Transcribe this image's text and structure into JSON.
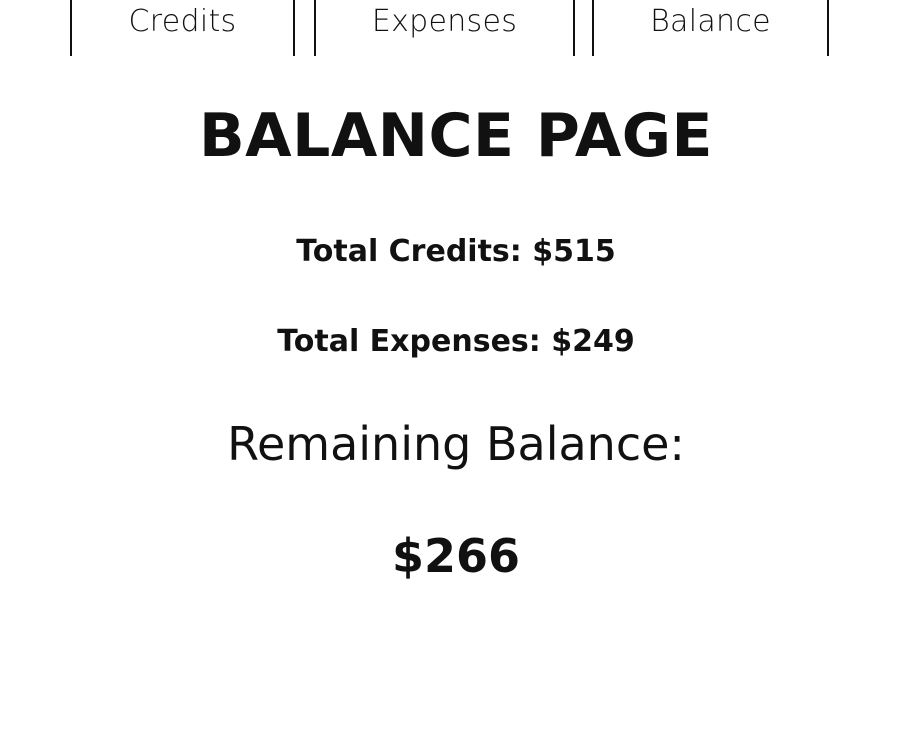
{
  "nav": {
    "tabs": [
      {
        "label": "Credits"
      },
      {
        "label": "Expenses"
      },
      {
        "label": "Balance"
      }
    ]
  },
  "page": {
    "title": "BALANCE PAGE",
    "total_credits": "Total Credits: $515",
    "total_expenses": "Total Expenses: $249",
    "remaining_label": "Remaining Balance:",
    "remaining_value": "$266"
  },
  "colors": {
    "text": "#111111",
    "background": "#ffffff"
  }
}
